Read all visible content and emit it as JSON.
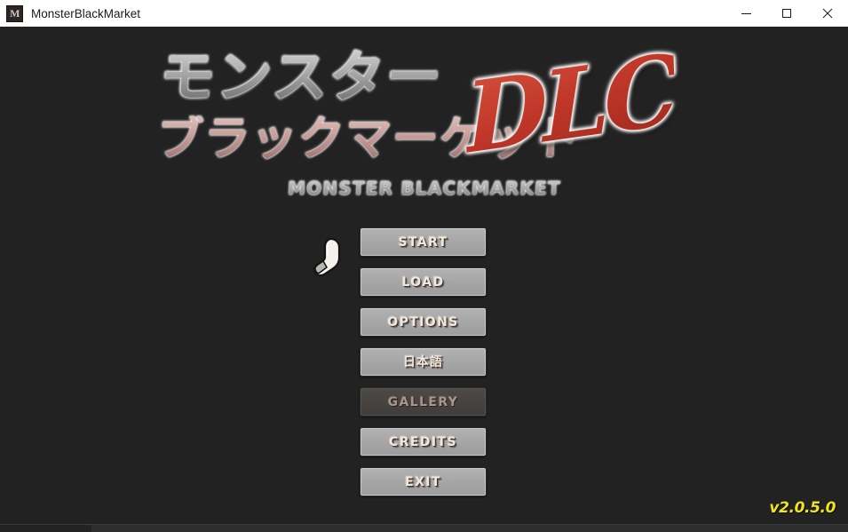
{
  "window": {
    "title": "MonsterBlackMarket",
    "app_icon": "monster-app-icon",
    "controls": {
      "minimize": "minimize-icon",
      "maximize": "maximize-icon",
      "close": "close-icon"
    }
  },
  "logo": {
    "kana_top": "モンスター",
    "kana_bottom": "ブラックマーケット",
    "dlc": "DLC",
    "subtitle": "MONSTER BLACKMARKET",
    "colors": {
      "kana_top": "#a9a9a9",
      "kana_bottom": "#c79a95",
      "dlc": "#c0392b",
      "outline": "#ffffff"
    }
  },
  "menu": {
    "items": [
      {
        "id": "start",
        "label": "START",
        "enabled": true
      },
      {
        "id": "load",
        "label": "LOAD",
        "enabled": true
      },
      {
        "id": "options",
        "label": "OPTIONS",
        "enabled": true
      },
      {
        "id": "language",
        "label": "日本語",
        "enabled": true
      },
      {
        "id": "gallery",
        "label": "GALLERY",
        "enabled": false
      },
      {
        "id": "credits",
        "label": "CREDITS",
        "enabled": true
      },
      {
        "id": "exit",
        "label": "EXIT",
        "enabled": true
      }
    ]
  },
  "cursor": {
    "icon": "pointing-hand-cursor"
  },
  "footer": {
    "version": "v2.0.5.0",
    "version_color": "#f2e41c"
  },
  "background": {
    "game_color": "#222222",
    "titlebar_color": "#ffffff"
  }
}
